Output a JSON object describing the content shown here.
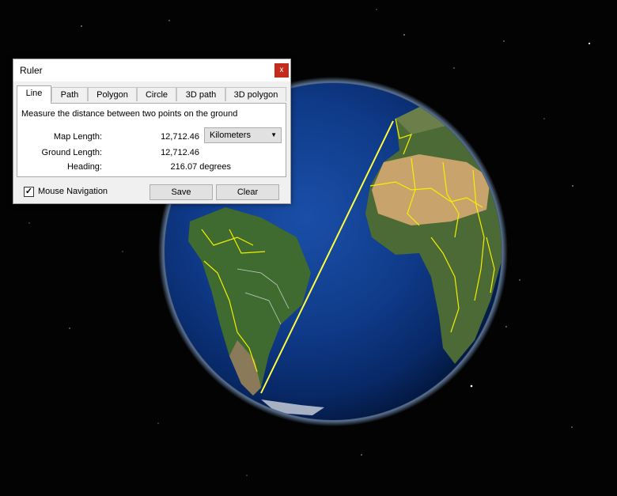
{
  "map": {
    "measure_line_color": "#ffff3c",
    "border_color": "#f4f000"
  },
  "ruler": {
    "title": "Ruler",
    "close_label": "x",
    "tabs": [
      "Line",
      "Path",
      "Polygon",
      "Circle",
      "3D path",
      "3D polygon"
    ],
    "active_tab": "Line",
    "description": "Measure the distance between two points on the ground",
    "map_length_label": "Map Length:",
    "map_length_value": "12,712.46",
    "units_value": "Kilometers",
    "ground_length_label": "Ground Length:",
    "ground_length_value": "12,712.46",
    "heading_label": "Heading:",
    "heading_value": "216.07 degrees",
    "mouse_navigation_label": "Mouse Navigation",
    "mouse_navigation_checked": true,
    "save_label": "Save",
    "clear_label": "Clear"
  }
}
